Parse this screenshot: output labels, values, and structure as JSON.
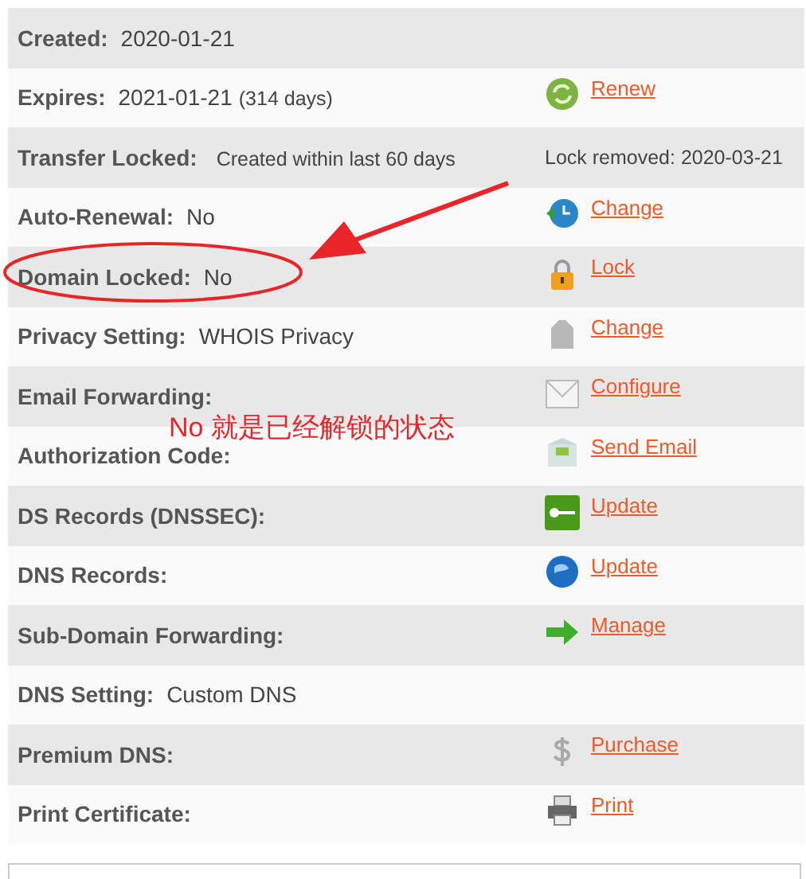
{
  "rows": [
    {
      "label": "Created:",
      "value": "2020-01-21"
    },
    {
      "label": "Expires:",
      "value": "2021-01-21",
      "note": "(314 days)",
      "link": "Renew"
    },
    {
      "label": "Transfer Locked:",
      "note": "Created within last 60 days",
      "side_text": "Lock removed: 2020-03-21"
    },
    {
      "label": "Auto-Renewal:",
      "value": "No",
      "link": "Change"
    },
    {
      "label": "Domain Locked:",
      "value": "No",
      "link": "Lock"
    },
    {
      "label": "Privacy Setting:",
      "value": "WHOIS Privacy",
      "link": "Change"
    },
    {
      "label": "Email Forwarding:",
      "link": "Configure"
    },
    {
      "label": "Authorization Code:",
      "link": "Send Email"
    },
    {
      "label": "DS Records (DNSSEC):",
      "link": "Update"
    },
    {
      "label": "DNS Records:",
      "link": "Update"
    },
    {
      "label": "Sub-Domain Forwarding:",
      "link": "Manage"
    },
    {
      "label": "DNS Setting:",
      "value": "Custom DNS"
    },
    {
      "label": "Premium DNS:",
      "link": "Purchase"
    },
    {
      "label": "Print Certificate:",
      "link": "Print"
    }
  ],
  "annotation": {
    "text": "No 就是已经解锁的状态"
  }
}
